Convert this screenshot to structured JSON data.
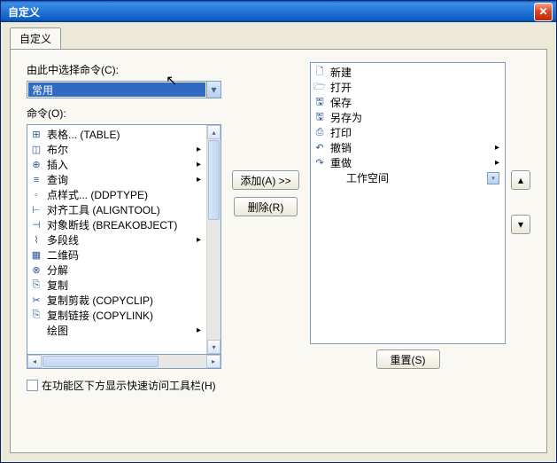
{
  "window": {
    "title": "自定义"
  },
  "tab": {
    "label": "自定义"
  },
  "left": {
    "chooseLabel": "由此中选择命令(C):",
    "combo": "常用",
    "cmdLabel": "命令(O):",
    "items": [
      {
        "icon": "⊞",
        "text": "表格... (TABLE)"
      },
      {
        "icon": "◫",
        "text": "布尔"
      },
      {
        "icon": "⊕",
        "text": "插入"
      },
      {
        "icon": "≡",
        "text": "查询"
      },
      {
        "icon": "◦",
        "text": "点样式... (DDPTYPE)"
      },
      {
        "icon": "⊢",
        "text": "对齐工具 (ALIGNTOOL)"
      },
      {
        "icon": "⊣",
        "text": "对象断线 (BREAKOBJECT)"
      },
      {
        "icon": "⌇",
        "text": "多段线"
      },
      {
        "icon": "▦",
        "text": "二维码"
      },
      {
        "icon": "⊗",
        "text": "分解"
      },
      {
        "icon": "⎘",
        "text": "复制"
      },
      {
        "icon": "✂",
        "text": "复制剪裁 (COPYCLIP)"
      },
      {
        "icon": "⎘",
        "text": "复制链接 (COPYLINK)"
      },
      {
        "icon": "",
        "text": "绘图"
      }
    ],
    "arrowIdx": {
      "1": true,
      "2": true,
      "3": true,
      "7": true,
      "13": true
    }
  },
  "mid": {
    "add": "添加(A) >>",
    "del": "删除(R)"
  },
  "right": {
    "items": [
      {
        "icon": "🗋",
        "text": "新建"
      },
      {
        "icon": "🗁",
        "text": "打开"
      },
      {
        "icon": "🖫",
        "text": "保存"
      },
      {
        "icon": "🖫",
        "text": "另存为"
      },
      {
        "icon": "⎙",
        "text": "打印"
      },
      {
        "icon": "↶",
        "text": "撤销",
        "arrow": true
      },
      {
        "icon": "↷",
        "text": "重做",
        "arrow": true
      },
      {
        "icon": "",
        "text": "工作空间",
        "indent": true,
        "dd": true
      }
    ],
    "reset": "重置(S)"
  },
  "checkbox": {
    "label": "在功能区下方显示快速访问工具栏(H)"
  }
}
